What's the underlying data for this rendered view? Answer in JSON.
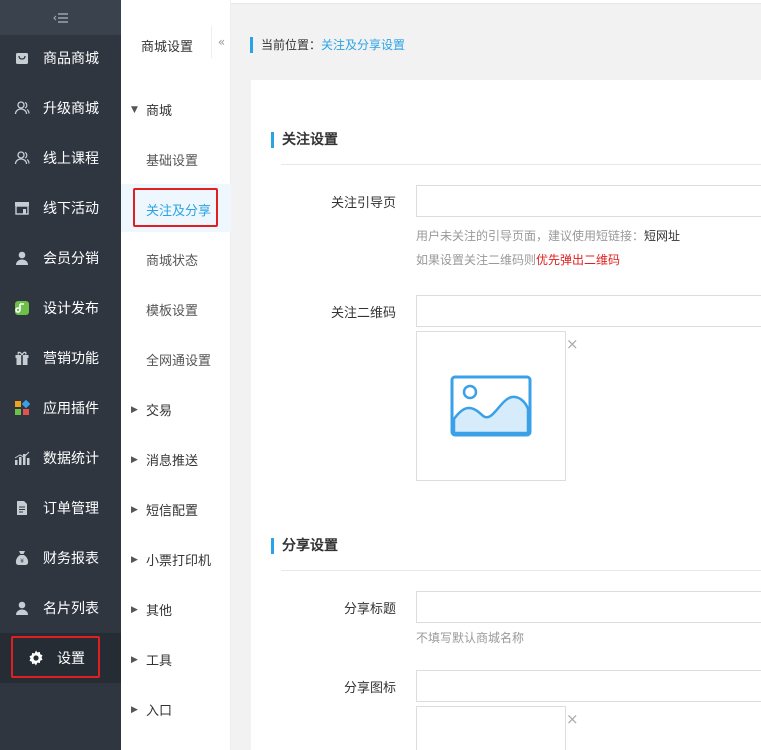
{
  "sidebar": {
    "items": [
      {
        "label": "商品商城",
        "icon": "shopping-bag-icon"
      },
      {
        "label": "升级商城",
        "icon": "users-icon"
      },
      {
        "label": "线上课程",
        "icon": "users-icon"
      },
      {
        "label": "线下活动",
        "icon": "store-icon"
      },
      {
        "label": "会员分销",
        "icon": "user-icon"
      },
      {
        "label": "设计发布",
        "icon": "design-app-icon"
      },
      {
        "label": "营销功能",
        "icon": "gift-icon"
      },
      {
        "label": "应用插件",
        "icon": "apps-grid-icon"
      },
      {
        "label": "数据统计",
        "icon": "bar-chart-icon"
      },
      {
        "label": "订单管理",
        "icon": "document-icon"
      },
      {
        "label": "财务报表",
        "icon": "money-bag-icon"
      },
      {
        "label": "名片列表",
        "icon": "user-icon"
      },
      {
        "label": "设置",
        "icon": "gear-icon"
      }
    ]
  },
  "subnav": {
    "title": "商城设置",
    "groups": {
      "mall": "商城",
      "trade": "交易",
      "push": "消息推送",
      "sms": "短信配置",
      "printer": "小票打印机",
      "other": "其他",
      "tools": "工具",
      "entry": "入口"
    },
    "items": {
      "basic": "基础设置",
      "follow_share": "关注及分享",
      "status": "商城状态",
      "template": "模板设置",
      "omni": "全网通设置"
    },
    "fold_icon": "«"
  },
  "breadcrumb": {
    "prefix": "当前位置：",
    "current": "关注及分享设置"
  },
  "follow_section": {
    "title": "关注设置",
    "guide_label": "关注引导页",
    "guide_value": "",
    "guide_hint_prefix": "用户未关注的引导页面，建议使用短链接：",
    "guide_hint_link": "短网址",
    "qr_hint_prefix": "如果设置关注二维码则",
    "qr_hint_red": "优先弹出二维码",
    "qr_label": "关注二维码",
    "qr_value": ""
  },
  "share_section": {
    "title": "分享设置",
    "title_label": "分享标题",
    "title_value": "",
    "title_hint": "不填写默认商城名称",
    "icon_label": "分享图标",
    "icon_value": ""
  },
  "close_glyph": "×",
  "colors": {
    "accent": "#29a3e6",
    "sidebar_bg": "#2f3640",
    "highlight_border": "#e02020"
  }
}
